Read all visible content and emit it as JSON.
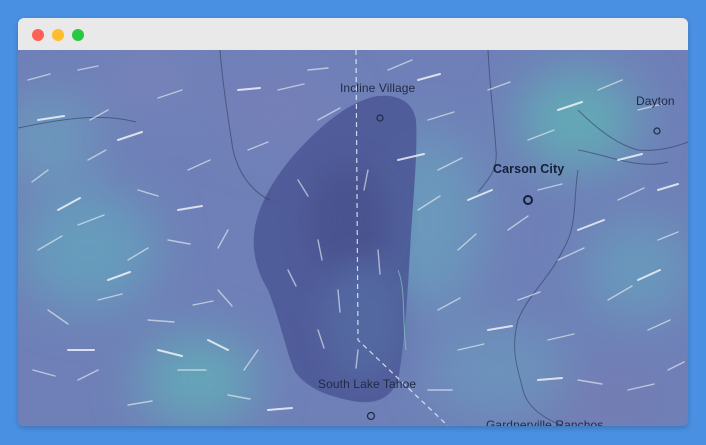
{
  "window": {
    "controls": [
      "close",
      "minimize",
      "zoom"
    ]
  },
  "map": {
    "places": [
      {
        "name": "Incline Village",
        "key": "incline_village"
      },
      {
        "name": "Dayton",
        "key": "dayton"
      },
      {
        "name": "Carson City",
        "key": "carson_city"
      },
      {
        "name": "South Lake Tahoe",
        "key": "south_lake_tahoe"
      },
      {
        "name": "Gardnerville Ranchos",
        "key": "gardnerville_ranchos"
      }
    ],
    "colors": {
      "base": "#6f80b8",
      "wind_high": "#5fb0b8",
      "lake": "#4b5897",
      "boundary": "#2a3550",
      "streak": "#ffffff"
    },
    "overlay": "wind-streamlines"
  }
}
